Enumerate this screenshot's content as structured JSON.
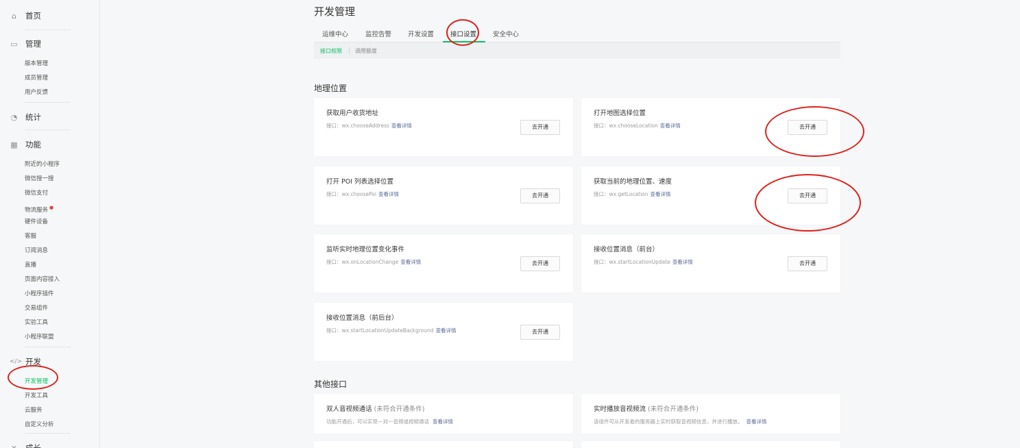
{
  "sidebar": {
    "home": "首页",
    "manage": {
      "label": "管理",
      "items": [
        "版本管理",
        "成员管理",
        "用户反馈"
      ]
    },
    "stats": "统计",
    "features": {
      "label": "功能",
      "items": [
        "附近的小程序",
        "微信搜一搜",
        "微信支付",
        "物流服务",
        "硬件设备",
        "客服",
        "订阅消息",
        "直播",
        "页面内容接入",
        "小程序插件",
        "交易组件",
        "实验工具",
        "小程序联盟"
      ]
    },
    "dev": {
      "label": "开发",
      "items": [
        "开发管理",
        "开发工具",
        "云服务",
        "自定义分析"
      ]
    },
    "growth": "成长"
  },
  "page": {
    "title": "开发管理",
    "tabs": [
      "运维中心",
      "监控告警",
      "开发设置",
      "接口设置",
      "安全中心"
    ],
    "active_tab": "接口设置",
    "subtabs": [
      "接口权限",
      "调用额度"
    ]
  },
  "geo": {
    "title": "地理位置",
    "prefix": "接口：",
    "link": "查看详情",
    "button": "去开通",
    "cards": [
      {
        "title": "获取用户收货地址",
        "api": "wx.chooseAddress"
      },
      {
        "title": "打开地图选择位置",
        "api": "wx.chooseLocation"
      },
      {
        "title": "打开 POI 列表选择位置",
        "api": "wx.choosePoi"
      },
      {
        "title": "获取当前的地理位置、速度",
        "api": "wx.getLocation"
      },
      {
        "title": "监听实时地理位置变化事件",
        "api": "wx.onLocationChange"
      },
      {
        "title": "接收位置消息（前台）",
        "api": "wx.startLocationUpdate"
      },
      {
        "title": "接收位置消息（前后台）",
        "api": "wx.startLocationUpdateBackground"
      }
    ]
  },
  "other": {
    "title": "其他接口",
    "cards": [
      {
        "title": "双人音视频通话",
        "status": "(未符合开通条件)",
        "desc": "功能开通后，可以实现一对一音频或视频通话",
        "link": "查看详情"
      },
      {
        "title": "实时播放音视频流",
        "status": "(未符合开通条件)",
        "desc": "该组件可从开发者的服务器上实时获取音视频信息，并进行播放。",
        "link": "查看详情"
      }
    ]
  },
  "colors": {
    "accent": "#07c160",
    "link": "#576b95",
    "annotation": "#e0201b"
  }
}
